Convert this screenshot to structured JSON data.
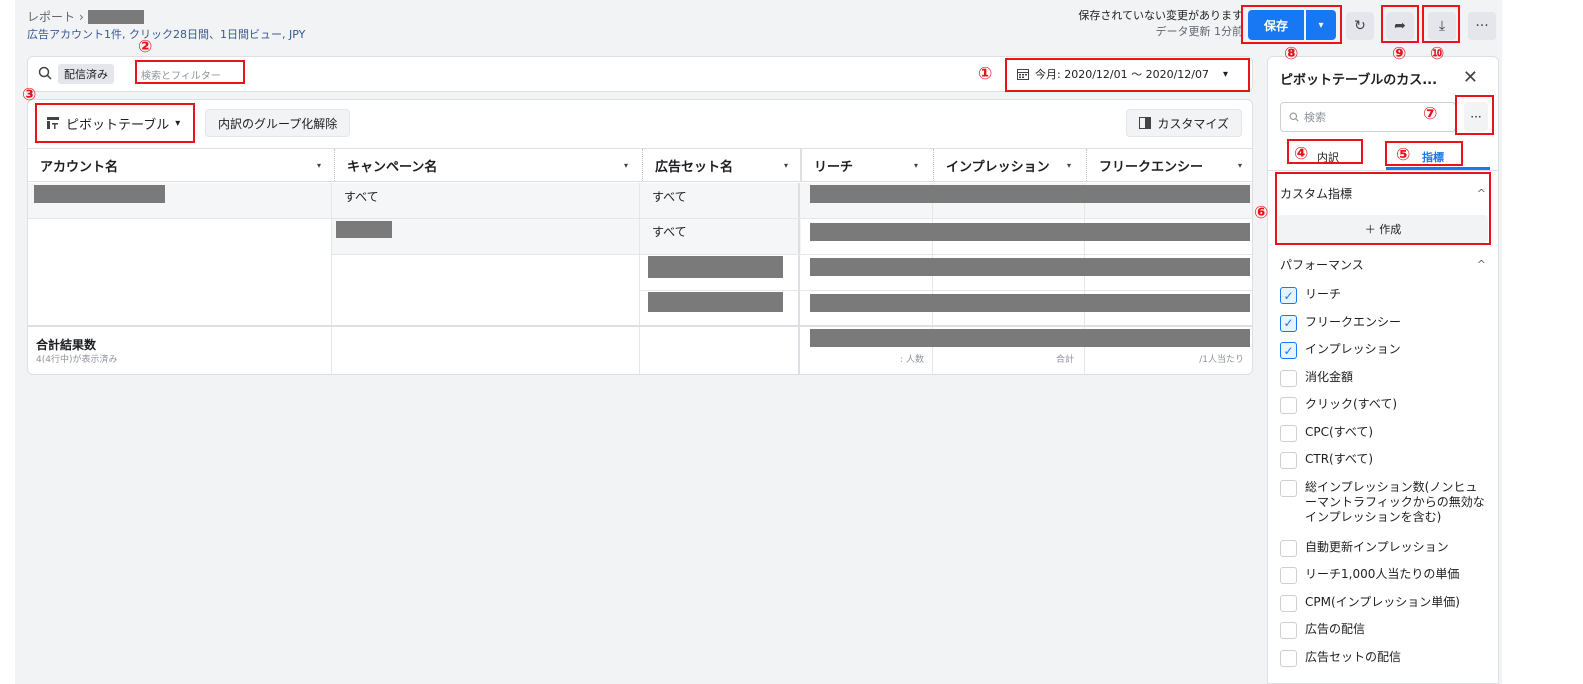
{
  "header": {
    "breadcrumb_root": "レポート",
    "breadcrumb_sep": "›",
    "subtitle": "広告アカウント1件, クリック28日間、1日間ビュー, JPY",
    "unsaved_notice": "保存されていない変更があります",
    "data_update": "データ更新 1分前",
    "save_label": "保存",
    "save_dropdown": "▾",
    "refresh_icon": "↻",
    "share_icon": "➦",
    "download_icon": "⤓",
    "more_icon": "···"
  },
  "search": {
    "status_chip": "配信済み",
    "placeholder": "検索とフィルター",
    "date_range": "今月: 2020/12/01 ～ 2020/12/07",
    "date_caret": "▾"
  },
  "table": {
    "pivot_label": "ピボットテーブル",
    "pivot_caret": "▾",
    "ungroup_label": "内訳のグループ化解除",
    "customize_label": "カスタマイズ",
    "columns": [
      "アカウント名",
      "キャンペーン名",
      "広告セット名",
      "リーチ",
      "インプレッション",
      "フリークエンシー"
    ],
    "column_caret": "▾",
    "all_text": "すべて",
    "footer_label": "合計結果数",
    "footer_sub": "4(4行中)が表示済み",
    "footer_units": [
      ": 人数",
      "合計",
      "/1人当たり"
    ]
  },
  "panel": {
    "title": "ピボットテーブルのカス...",
    "close": "✕",
    "search_placeholder": "検索",
    "more": "···",
    "tab_breakdown": "内訳",
    "tab_metrics": "指標",
    "section_custom": "カスタム指標",
    "create_label": "＋ 作成",
    "section_performance": "パフォーマンス",
    "chevron": "^",
    "metrics": [
      {
        "label": "リーチ",
        "checked": true
      },
      {
        "label": "フリークエンシー",
        "checked": true
      },
      {
        "label": "インプレッション",
        "checked": true
      },
      {
        "label": "消化金額",
        "checked": false
      },
      {
        "label": "クリック(すべて)",
        "checked": false
      },
      {
        "label": "CPC(すべて)",
        "checked": false
      },
      {
        "label": "CTR(すべて)",
        "checked": false
      },
      {
        "label": "総インプレッション数(ノンヒューマントラフィックからの無効なインプレッションを含む)",
        "checked": false
      },
      {
        "label": "自動更新インプレッション",
        "checked": false
      },
      {
        "label": "リーチ1,000人当たりの単価",
        "checked": false
      },
      {
        "label": "CPM(インプレッション単価)",
        "checked": false
      },
      {
        "label": "広告の配信",
        "checked": false
      },
      {
        "label": "広告セットの配信",
        "checked": false
      }
    ]
  },
  "annotations": [
    "①",
    "②",
    "③",
    "④",
    "⑤",
    "⑥",
    "⑦",
    "⑧",
    "⑨",
    "⑩"
  ],
  "colors": {
    "accent": "#1877f2",
    "annotation": "#e8131b",
    "redaction": "#7a7a7a"
  }
}
